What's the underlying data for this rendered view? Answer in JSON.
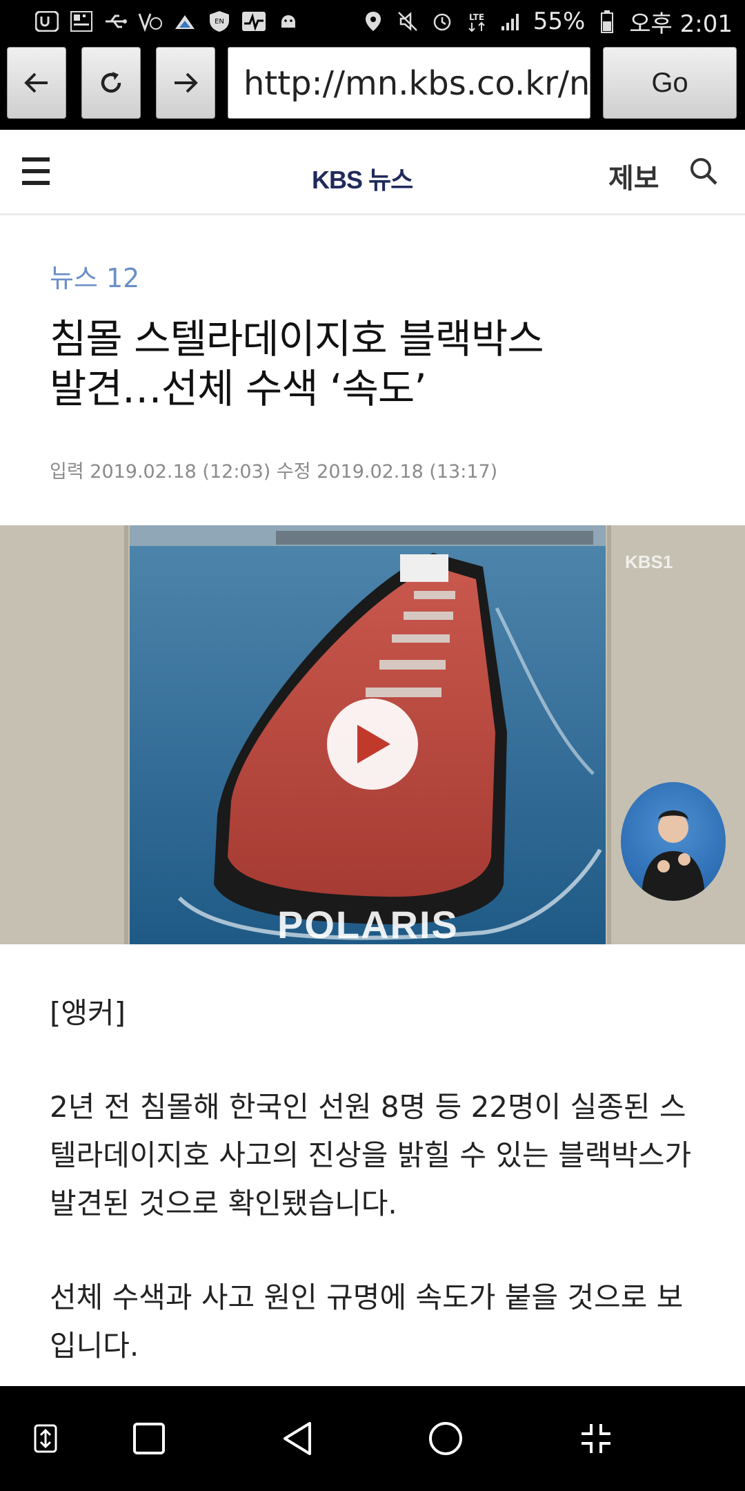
{
  "status_bar": {
    "left_icons": [
      "u-plus-icon",
      "qr-app-icon",
      "usb-icon",
      "volte-icon",
      "weather-icon",
      "vpn-shield-icon",
      "activity-icon",
      "android-debug-icon"
    ],
    "right_icons": [
      "location-icon",
      "mute-icon",
      "alarm-icon",
      "lte-icon",
      "signal-icon"
    ],
    "battery_percent": "55%",
    "time": "오후 2:01"
  },
  "browser": {
    "back_icon": "arrow-left-icon",
    "reload_icon": "reload-icon",
    "forward_icon": "arrow-right-icon",
    "url": "http://mn.kbs.co.kr/n",
    "go_label": "Go"
  },
  "site_header": {
    "logo_brand": "KBS",
    "logo_sub": "뉴스",
    "report_label": "제보"
  },
  "article": {
    "program": "뉴스 12",
    "headline_line1": "침몰 스텔라데이지호 블랙박스",
    "headline_line2": "발견…선체 수색 ‘속도’",
    "dates": "입력 2019.02.18 (12:03) 수정 2019.02.18 (13:17)",
    "paragraphs": [
      "[앵커]",
      "2년 전 침몰해 한국인 선원 8명 등 22명이 실종된 스텔라데이지호 사고의 진상을 밝힐 수 있는 블랙박스가 발견된 것으로 확인됐습니다.",
      "선체 수색과 사고 원인 규명에 속도가 붙을 것으로 보입니다."
    ]
  },
  "video": {
    "broadcaster_mark": "KBS1",
    "poster_brand": "POLARIS",
    "play_icon": "play-icon"
  },
  "colors": {
    "program_blue": "#6a8fc7",
    "logo_navy": "#1f2a5c",
    "ship_red": "#b8463f",
    "sea_blue": "#2f6d9c"
  },
  "nav_bar": {
    "icons": [
      "resize-icon",
      "recents-icon",
      "back-icon",
      "home-icon",
      "collapse-icon"
    ]
  }
}
